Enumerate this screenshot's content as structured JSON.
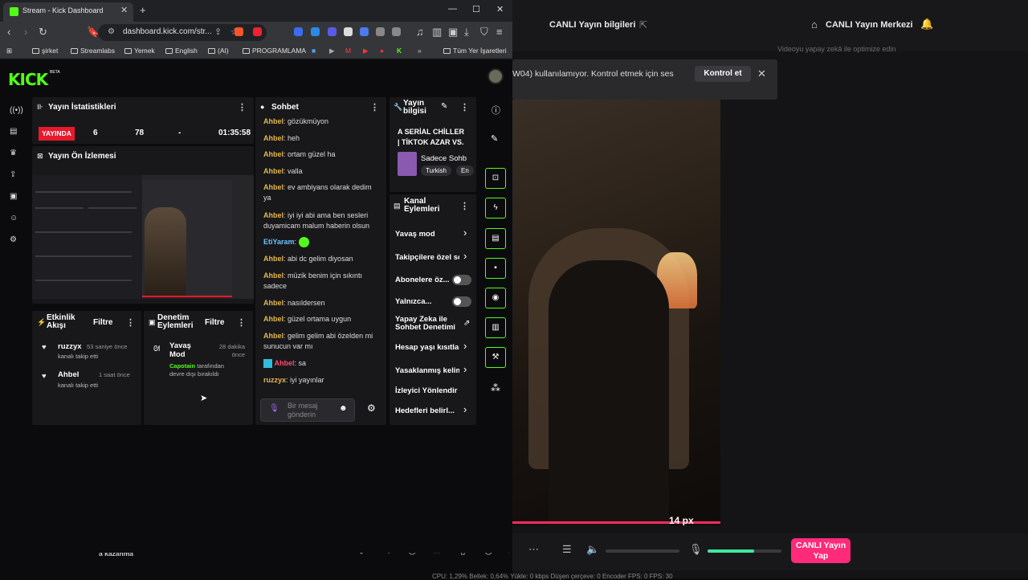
{
  "background_app": {
    "title": "CANLI Yayın bilgileri",
    "right_title": "CANLI Yayın Merkezi",
    "subtitle": "Videoyu yapay zekâ ile optimize edin",
    "notice_text": "W04) kullanılamıyor. Kontrol etmek için ses",
    "notice_button": "Kontrol et",
    "video_overlay": "14 px",
    "live_button": "CANLI Yayın Yap",
    "bottom_left_text": "a kazanma",
    "stats_text": "CPU: 1,29%    Bellek: 0,64%    Yükle: 0 kbps    Düşen çerçeve: 0    Encoder FPS: 0    FPS: 30",
    "mic_level": 0.63,
    "accent": "#ff2a7a"
  },
  "browser": {
    "tab_title": "Stream - Kick Dashboard",
    "url": "dashboard.kick.com/str...",
    "bookmarks": [
      "şirket",
      "Streamlabs",
      "Yemek",
      "English",
      "(AI)",
      "PROGRAMLAMA",
      "Tüm Yer İşaretleri"
    ]
  },
  "kick": {
    "logo": "KICK",
    "beta": "BETA",
    "stats_panel": {
      "title": "Yayın İstatistikleri",
      "live_badge": "YAYINDA",
      "viewers": "6",
      "followers": "78",
      "subs": "-",
      "duration": "01:35:58"
    },
    "preview_panel": {
      "title": "Yayın Ön İzlemesi"
    },
    "activity_panel": {
      "title_line1": "Etkinlik",
      "title_line2": "Akışı",
      "filter": "Filtre",
      "items": [
        {
          "user": "ruzzyx",
          "time": "53 saniye önce",
          "desc": "kanalı takip etti"
        },
        {
          "user": "Ahbel",
          "time": "1 saat önce",
          "desc": "kanalı takip etti"
        }
      ]
    },
    "moderation_panel": {
      "title_line1": "Denetim",
      "title_line2": "Eylemleri",
      "filter": "Filtre",
      "item_title_1": "Yavaş",
      "item_title_2": "Mod",
      "item_time_1": "28 dakika",
      "item_time_2": "önce",
      "actor": "Capotain",
      "desc_1": "tarafından",
      "desc_2": "devre dışı bırakıldı"
    },
    "chat_panel": {
      "title": "Sohbet",
      "messages": [
        {
          "user": "Ahbel",
          "text": "gözükmüyon"
        },
        {
          "user": "Ahbel",
          "text": "heh"
        },
        {
          "user": "Ahbel",
          "text": "ortam güzel ha"
        },
        {
          "user": "Ahbel",
          "text": "valla"
        },
        {
          "user": "Ahbel",
          "text": "ev ambiyans olarak dedim ya"
        },
        {
          "user": "Ahbel",
          "text": "iyi iyi abi ama ben sesleri duyamicam malum haberin olsun"
        },
        {
          "user": "EtiYaram",
          "text": ""
        },
        {
          "user": "Ahbel",
          "text": "abi dc gelim diyosan"
        },
        {
          "user": "Ahbel",
          "text": "müzik benim için sıkıntı sadece"
        },
        {
          "user": "Ahbel",
          "text": "nasıldersen"
        },
        {
          "user": "Ahbel",
          "text": "güzel ortama uygun"
        },
        {
          "user": "Ahbel",
          "text": "gelim gelim abi özelden mi sunucun var mı"
        },
        {
          "user": "Ahbel",
          "text": "sa"
        },
        {
          "user": "ruzzyx",
          "text": "iyi yayınlar"
        }
      ],
      "input_placeholder_1": "Bir mesaj",
      "input_placeholder_2": "gönderin"
    },
    "stream_info_panel": {
      "title_line1": "Yayın",
      "title_line2": "bilgisi",
      "stream_title_1": "A SERİAL CHİLLER",
      "stream_title_2": "| TİKTOK AZAR VS.",
      "category": "Sadece Sohb",
      "tags": [
        "Turkish",
        "En"
      ]
    },
    "channel_actions_panel": {
      "title_line1": "Kanal",
      "title_line2": "Eylemleri",
      "rows": [
        "Yavaş mod",
        "Takipçilere özel sohbet",
        "Abonelere öz...",
        "Yalnızca...",
        "Yapay Zeka ile",
        "Sohbet Denetimi",
        "Hesap yaşı kısıtlaması",
        "Yasaklanmış kelimeler",
        "İzleyici Yönlendir",
        "Hedefleri belirl..."
      ]
    },
    "colors": {
      "accent": "#53fc18",
      "live": "#e8192c",
      "username": "#e6b84a",
      "username_alt": "#6cc1ff"
    }
  }
}
